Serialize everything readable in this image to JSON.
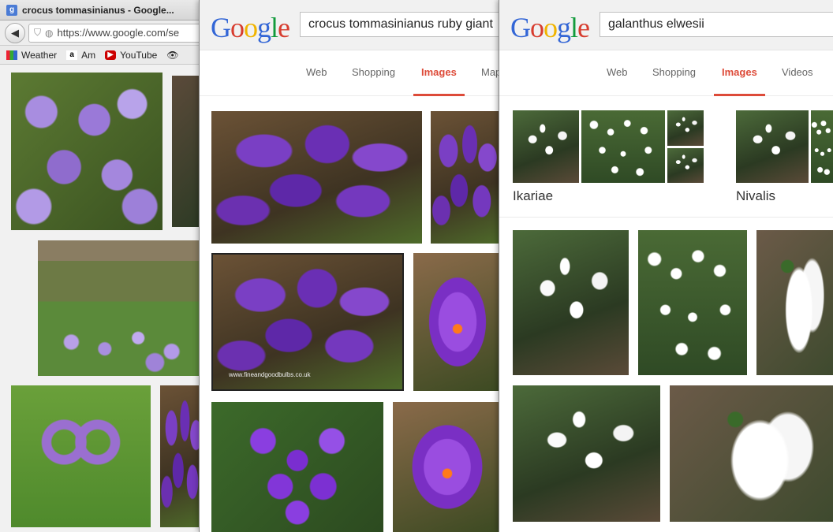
{
  "browser": {
    "tab_title": "crocus tommasinianus - Google...",
    "favicon_letter": "g",
    "url": "https://www.google.com/se",
    "bookmarks": [
      "Weather",
      "Am",
      "YouTube"
    ]
  },
  "left_search": {
    "query": "crocus tommasinianus ruby giant",
    "tabs": [
      "Web",
      "Shopping",
      "Images",
      "Map"
    ],
    "active_tab": "Images",
    "watermark": "www.fineandgoodbulbs.co.uk"
  },
  "right_search": {
    "query": "galanthus elwesii",
    "tabs": [
      "Web",
      "Shopping",
      "Images",
      "Videos"
    ],
    "active_tab": "Images",
    "related_categories": [
      "Ikariae",
      "Nivalis"
    ]
  },
  "logo_letters": [
    "G",
    "o",
    "o",
    "g",
    "l",
    "e"
  ],
  "colors": {
    "active_tab": "#dd4b39",
    "crocus": "#8a4fd0",
    "header_bg": "#f1f1f1"
  }
}
